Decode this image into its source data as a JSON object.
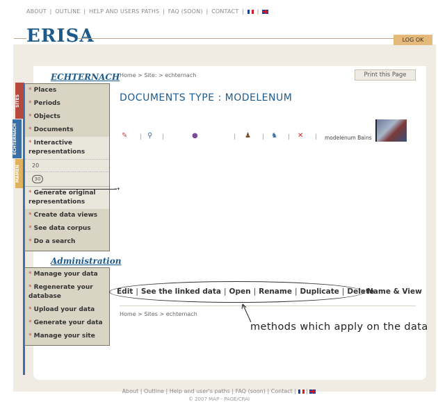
{
  "topnav": {
    "about": "ABOUT",
    "outline": "OUTLINE",
    "help": "HELP AND USERS PATHS",
    "faq": "FAQ (SOON)",
    "contact": "CONTACT",
    "separator": "|"
  },
  "brand": {
    "logo": "ERISA",
    "login": "LOG OK"
  },
  "sidebar": {
    "section1_title": "ECHTERNACH",
    "vtabs": [
      "SITES",
      "ECHTERNACH",
      "MAMEN"
    ],
    "items_top": [
      "Places",
      "Periods",
      "Objects",
      "Documents"
    ],
    "interactive": "Interactive representations",
    "sub_20": "20",
    "sub_30": "30",
    "items_bottom": [
      "Generate original representations",
      "Create data views",
      "See data corpus",
      "Do a search"
    ],
    "section2_title": "Administration",
    "admin_items": [
      "Manage your data",
      "Regenerate your database",
      "Upload your data",
      "Generate your data",
      "Manage your site"
    ]
  },
  "main": {
    "breadcrumb": "Home > Site: > echternach",
    "print_label": "Print this Page",
    "heading": "DOCUMENTS TYPE : MODELENUM",
    "model_label": "modelenum Bains",
    "methods": [
      "Edit",
      "See the linked data",
      "Open",
      "Rename",
      "Duplicate",
      "Delete"
    ],
    "name_view": "Name & View",
    "breadcrumb_bottom": "Home > Sites > echternach",
    "annotation": "methods which apply on the data"
  },
  "icons": [
    "pencil-icon",
    "pin-icon",
    "molecule-icon",
    "user-edit-icon",
    "users-icon",
    "delete-x-icon"
  ],
  "footer": {
    "text": "About | Outline | Help and user's paths | FAQ (soon) | Contact |",
    "copyright": "© 2007 MAP - PAGE/CRAI"
  },
  "colors": {
    "accent": "#1d5a8c",
    "panel": "#d9d4c4",
    "login": "#e5b97a",
    "frame": "#f1ece3"
  }
}
